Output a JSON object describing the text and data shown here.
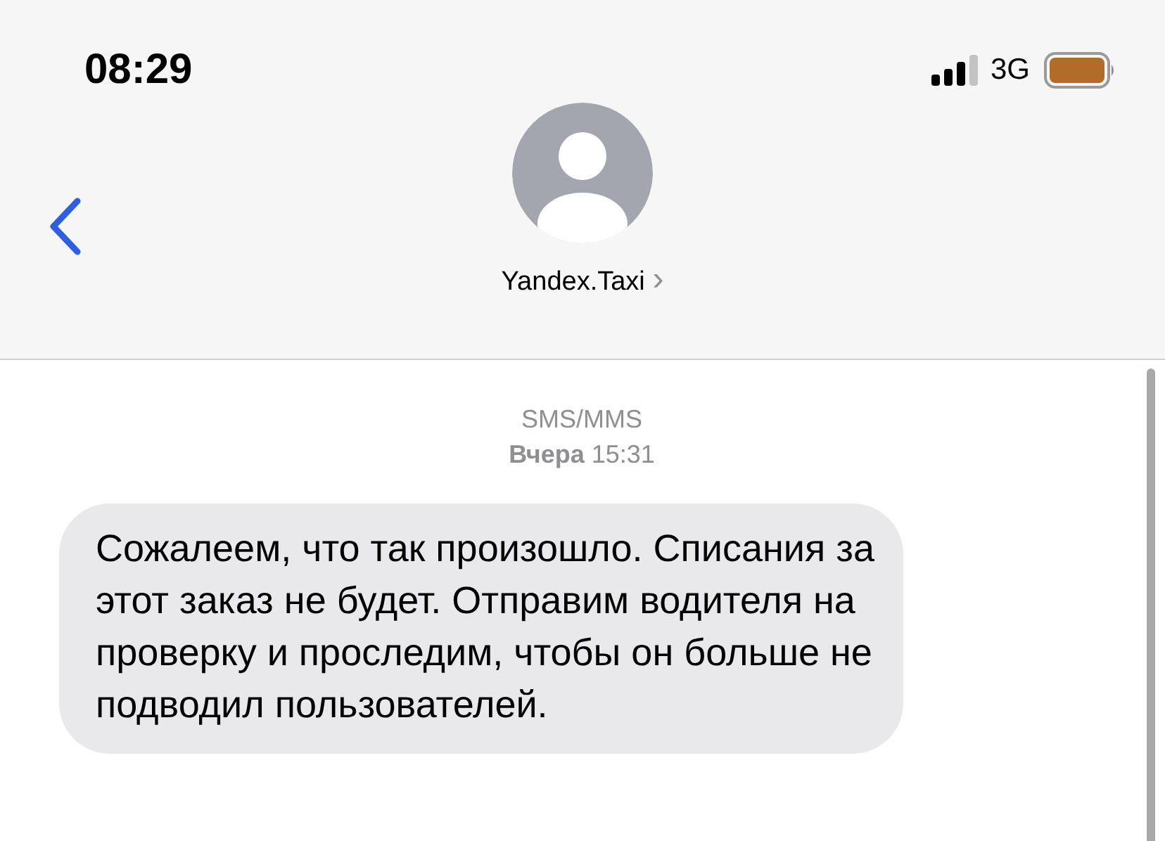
{
  "status_bar": {
    "time": "08:29",
    "network": "3G"
  },
  "header": {
    "contact": "Yandex.Taxi",
    "chevron": "›"
  },
  "thread": {
    "service": "SMS/MMS",
    "date": "Вчера",
    "time": "15:31",
    "messages": [
      {
        "text": "Сожалеем, что так произошло. Списания за этот заказ не будет. Отправим водителя на проверку и проследим, чтобы он больше не подводил пользователей."
      }
    ]
  }
}
